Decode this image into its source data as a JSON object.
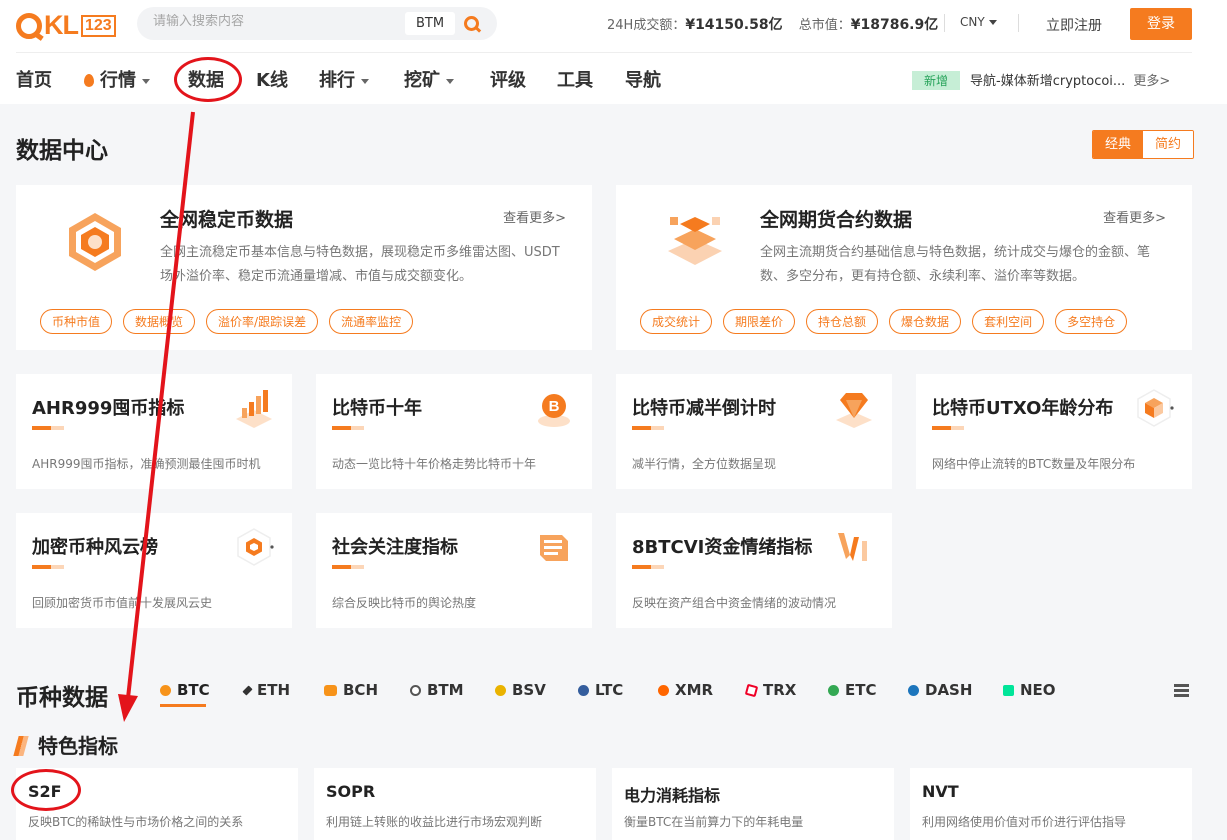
{
  "header": {
    "logo_text": "KL",
    "logo_num": "123",
    "search_placeholder": "请输入搜索内容",
    "search_tag": "BTM",
    "volume_label": "24H成交额：",
    "volume_value": "¥14150.58亿",
    "mcap_label": "总市值：",
    "mcap_value": "¥18786.9亿",
    "currency": "CNY",
    "register": "立即注册",
    "login": "登录"
  },
  "nav": {
    "items": [
      "首页",
      "行情",
      "数据",
      "K线",
      "排行",
      "挖矿",
      "评级",
      "工具",
      "导航"
    ],
    "news_badge": "新增",
    "news_text": "导航-媒体新增cryptocoi...",
    "news_more": "更多>"
  },
  "page": {
    "title": "数据中心",
    "view_classic": "经典",
    "view_simple": "简约"
  },
  "big_cards": [
    {
      "title": "全网稳定币数据",
      "more": "查看更多>",
      "desc": "全网主流稳定币基本信息与特色数据，展现稳定币多维雷达图、USDT场外溢价率、稳定币流通量增减、市值与成交额变化。",
      "tags": [
        "币种市值",
        "数据概览",
        "溢价率/跟踪误差",
        "流通率监控"
      ]
    },
    {
      "title": "全网期货合约数据",
      "more": "查看更多>",
      "desc": "全网主流期货合约基础信息与特色数据，统计成交与爆仓的金额、笔数、多空分布，更有持仓额、永续利率、溢价率等数据。",
      "tags": [
        "成交统计",
        "期限差价",
        "持仓总额",
        "爆仓数据",
        "套利空间",
        "多空持仓"
      ]
    }
  ],
  "small_cards": [
    {
      "title": "AHR999囤币指标",
      "desc": "AHR999囤币指标，准确预测最佳囤币时机"
    },
    {
      "title": "比特币十年",
      "desc": "动态一览比特十年价格走势比特币十年"
    },
    {
      "title": "比特币减半倒计时",
      "desc": "减半行情，全方位数据呈现"
    },
    {
      "title": "比特币UTXO年龄分布",
      "desc": "网络中停止流转的BTC数量及年限分布"
    },
    {
      "title": "加密币种风云榜",
      "desc": "回顾加密货币市值前十发展风云史"
    },
    {
      "title": "社会关注度指标",
      "desc": "综合反映比特币的舆论热度"
    },
    {
      "title": "8BTCVI资金情绪指标",
      "desc": "反映在资产组合中资金情绪的波动情况"
    }
  ],
  "coin_section": {
    "title": "币种数据",
    "coins": [
      "BTC",
      "ETH",
      "BCH",
      "BTM",
      "BSV",
      "LTC",
      "XMR",
      "TRX",
      "ETC",
      "DASH",
      "NEO"
    ],
    "coin_colors": [
      "#f7931a",
      "#333333",
      "#f7931a",
      "#555555",
      "#eab300",
      "#345d9d",
      "#ff6600",
      "#ef0027",
      "#33a853",
      "#1c75bc",
      "#00e599"
    ]
  },
  "features": {
    "title": "特色指标",
    "items": [
      {
        "title": "S2F",
        "desc": "反映BTC的稀缺性与市场价格之间的关系"
      },
      {
        "title": "SOPR",
        "desc": "利用链上转账的收益比进行市场宏观判断"
      },
      {
        "title": "电力消耗指标",
        "desc": "衡量BTC在当前算力下的年耗电量"
      },
      {
        "title": "NVT",
        "desc": "利用网络使用价值对币价进行评估指导"
      }
    ]
  }
}
